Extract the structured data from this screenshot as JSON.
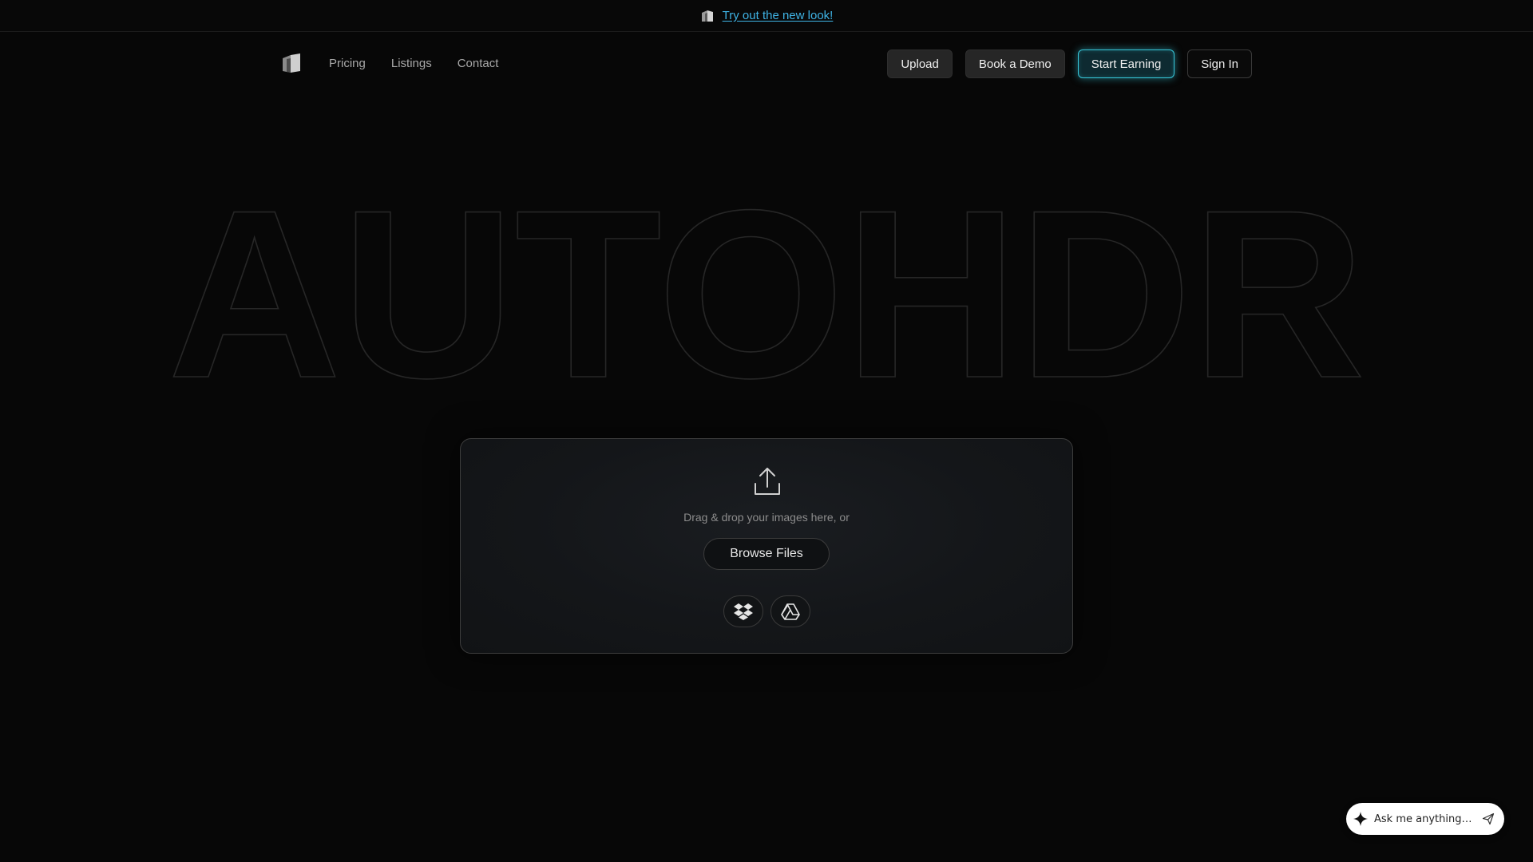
{
  "announcement": {
    "link_text": "Try out the new look!",
    "link_color": "#3fb4e6"
  },
  "nav": {
    "links": [
      {
        "label": "Pricing"
      },
      {
        "label": "Listings"
      },
      {
        "label": "Contact"
      }
    ],
    "actions": {
      "upload": "Upload",
      "book_demo": "Book a Demo",
      "start_earning": "Start Earning",
      "sign_in": "Sign In"
    },
    "accent_color": "#36c6d8"
  },
  "hero": {
    "wordmark": "AUTOHDR"
  },
  "upload": {
    "icon": "upload-icon",
    "prompt": "Drag & drop your images here, or",
    "browse_label": "Browse Files",
    "sources": [
      {
        "name": "dropbox-icon"
      },
      {
        "name": "google-drive-icon"
      }
    ]
  },
  "chat": {
    "placeholder": "Ask me anything…",
    "icon": "sparkle-icon",
    "send_icon": "send-icon"
  }
}
